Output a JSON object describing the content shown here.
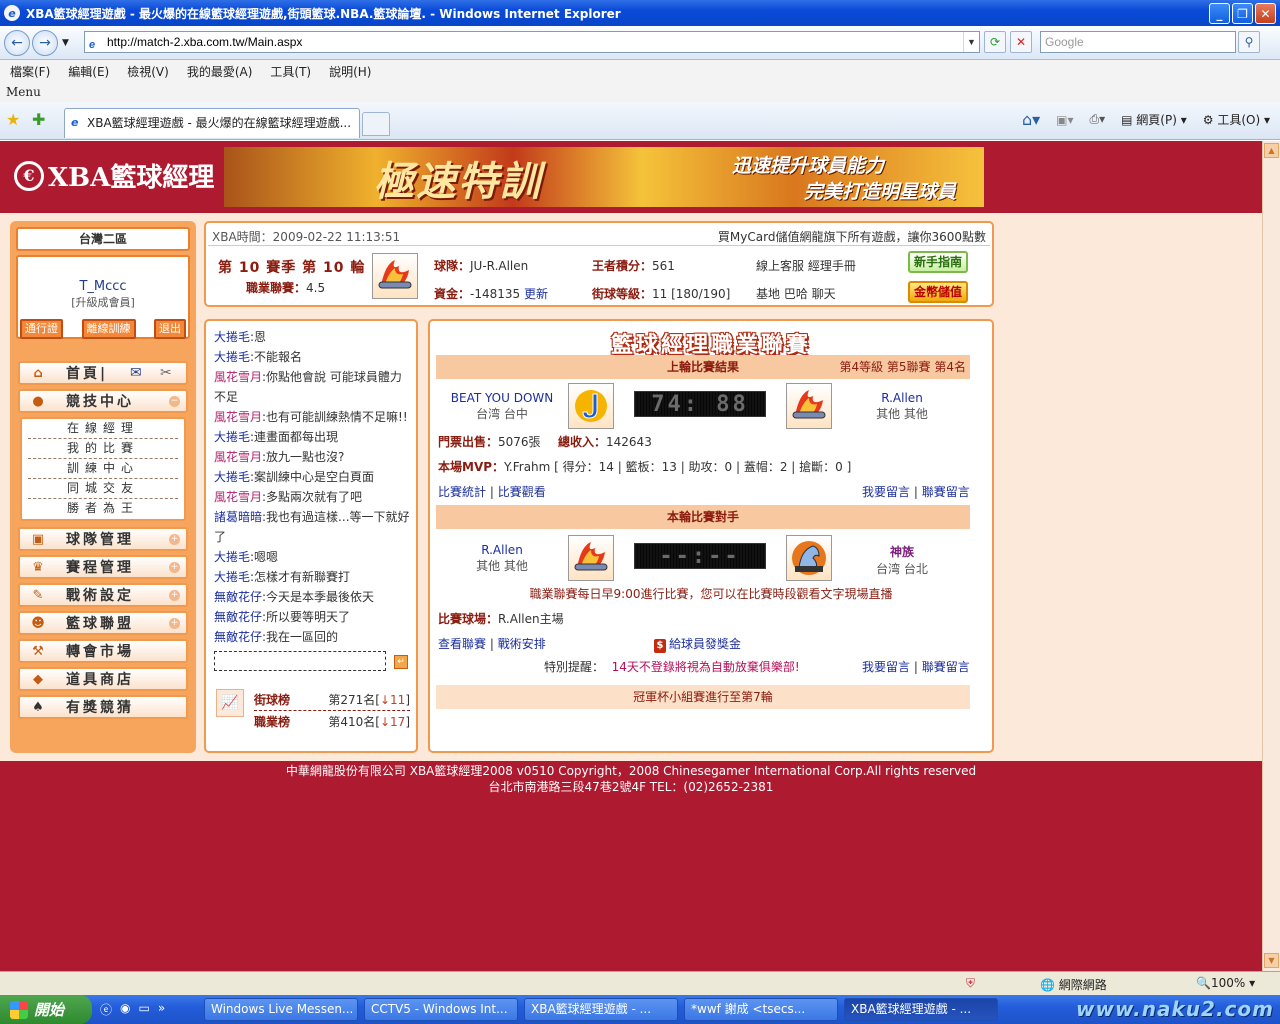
{
  "window": {
    "title": "XBA籃球經理遊戲 - 最火爆的在線籃球經理遊戲,街頭籃球.NBA.籃球論壇. - Windows Internet Explorer",
    "url": "http://match-2.xba.com.tw/Main.aspx",
    "search_placeholder": "Google",
    "menu": [
      "檔案(F)",
      "編輯(E)",
      "檢視(V)",
      "我的最愛(A)",
      "工具(T)",
      "說明(H)"
    ],
    "menu_label": "Menu",
    "tab_title": "XBA籃球經理遊戲 - 最火爆的在線籃球經理遊戲...",
    "toolbar_page": "網頁(P)",
    "toolbar_tools": "工具(O)"
  },
  "banner": {
    "logo": "XBA籃球經理",
    "ad_big": "極速特訓",
    "ad_line1": "迅速提升球員能力",
    "ad_line2": "完美打造明星球員"
  },
  "sidebar": {
    "server": "台灣二區",
    "username": "T_Mccc",
    "rank": "[升級成會員]",
    "buttons": [
      "通行證",
      "離線訓練",
      "退出"
    ],
    "home": "首頁|",
    "items": [
      "競技中心",
      "球隊管理",
      "賽程管理",
      "戰術設定",
      "籃球聯盟",
      "轉會市場",
      "道具商店",
      "有獎競猜"
    ],
    "submenu": [
      "在線經理",
      "我的比賽",
      "訓練中心",
      "同城交友",
      "勝者為王"
    ]
  },
  "info": {
    "time_label": "XBA時間：",
    "time": "2009-02-22 11:13:51",
    "promo": "買MyCard儲值網龍旗下所有遊戲，讓你3600點數",
    "season": "第 10 賽季 第 10 輪",
    "league_label": "職業聯賽：",
    "league_value": "4.5",
    "team_label": "球隊：",
    "team_value": "JU-R.Allen",
    "funds_label": "資金：",
    "funds_value": "-148135",
    "update": "更新",
    "king_label": "王者積分：",
    "king_value": "561",
    "street_label": "街球等級：",
    "street_value": "11 [180/190]",
    "links1": "線上客服  經理手冊",
    "links2": "基地  巴哈  聊天",
    "guide_btn": "新手指南",
    "coin_btn": "金幣儲值"
  },
  "chat": {
    "messages": [
      {
        "name": "大捲毛",
        "text": ":恩",
        "c": 1
      },
      {
        "name": "大捲毛",
        "text": ":不能報名",
        "c": 1
      },
      {
        "name": "風花雪月",
        "text": ":你點他會說 可能球員體力不足",
        "c": 2
      },
      {
        "name": "風花雪月",
        "text": ":也有可能訓練熱情不足嘛!!",
        "c": 2
      },
      {
        "name": "大捲毛",
        "text": ":連畫面都每出現",
        "c": 1
      },
      {
        "name": "風花雪月",
        "text": ":放九一點也沒?",
        "c": 2
      },
      {
        "name": "大捲毛",
        "text": ":案訓練中心是空白頁面",
        "c": 1
      },
      {
        "name": "風花雪月",
        "text": ":多點兩次就有了吧",
        "c": 2
      },
      {
        "name": "諸葛暗暗",
        "text": ":我也有過這樣...等一下就好了",
        "c": 1
      },
      {
        "name": "大捲毛",
        "text": ":嗯嗯",
        "c": 1
      },
      {
        "name": "大捲毛",
        "text": ":怎樣才有新聯賽打",
        "c": 1
      },
      {
        "name": "無敵花仔",
        "text": ":今天是本季最後依天",
        "c": 1
      },
      {
        "name": "無敵花仔",
        "text": ":所以要等明天了",
        "c": 1
      },
      {
        "name": "無敵花仔",
        "text": ":我在一區回的",
        "c": 1
      }
    ],
    "ranks": [
      {
        "label": "街球榜",
        "value": "第271名[",
        "delta": "↓11",
        "end": "]"
      },
      {
        "label": "職業榜",
        "value": "第410名[",
        "delta": "↓17",
        "end": "]"
      }
    ]
  },
  "league": {
    "title": "籃球經理職業聯賽",
    "last_title": "上輪比賽結果",
    "last_right": "第4等級  第5聯賽  第4名",
    "home_team": "BEAT YOU DOWN",
    "home_loc": "台湾  台中",
    "score": "74: 88",
    "away_team": "R.Allen",
    "away_loc": "其他  其他",
    "tickets_label": "門票出售：",
    "tickets": "5076張",
    "income_label": "總收入：",
    "income": "142643",
    "mvp_label": "本場MVP：",
    "mvp": "Y.Frahm [ 得分：14 | 籃板：13 | 助攻：0 | 蓋帽：2 | 搶斷：0 ]",
    "stats_link": "比賽統計",
    "watch_link": "比賽觀看",
    "msg_link1": "我要留言",
    "msg_link2": "聯賽留言",
    "next_title": "本輪比賽對手",
    "next_home": "R.Allen",
    "next_home_loc": "其他  其他",
    "next_score": "--:--",
    "next_away": "神族",
    "next_away_loc": "台湾  台北",
    "daily_note": "職業聯賽每日早9:00進行比賽，您可以在比賽時段觀看文字現場直播",
    "venue_label": "比賽球場：",
    "venue": "R.Allen主場",
    "view_league": "查看聯賽",
    "tactics": "戰術安排",
    "bonus": "給球員發獎金",
    "notice_label": "特別提醒：",
    "notice": "14天不登錄將視為自動放棄俱樂部!",
    "cup": "冠軍杯小組賽進行至第7輪"
  },
  "footer": {
    "line1": "中華網龍股份有限公司  XBA籃球經理2008 v0510     Copyright，2008 Chinesegamer International Corp.All rights reserved",
    "line2": "台北市南港路三段47巷2號4F TEL：(02)2652-2381"
  },
  "status": {
    "zone": "網際網路",
    "zoom": "100%"
  },
  "taskbar": {
    "start": "開始",
    "tasks": [
      "Windows Live Messen...",
      "CCTV5 - Windows Int...",
      "XBA籃球經理遊戲 - ...",
      "*wwf        謝成 <tsecs...",
      "XBA籃球經理遊戲 - ..."
    ],
    "watermark": "www.naku2.com"
  },
  "colors": {
    "page_bg": "#ae1a30",
    "panel_border": "#f09a50",
    "content_bg": "#fde9d9"
  }
}
